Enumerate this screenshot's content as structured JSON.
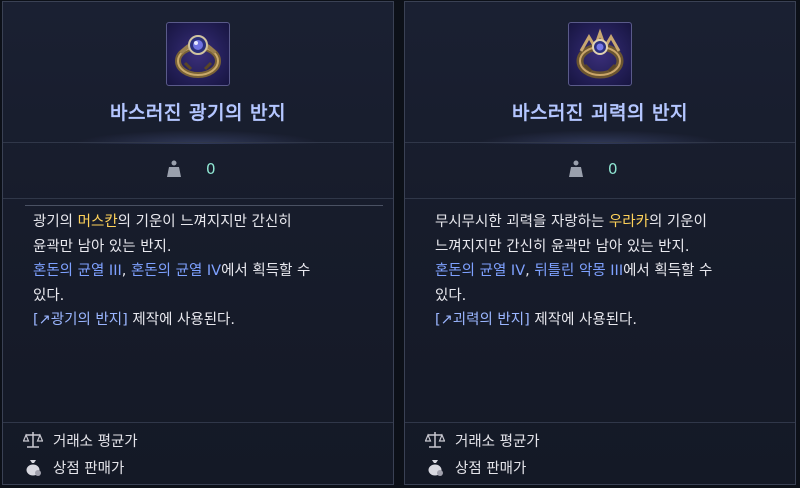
{
  "cards": [
    {
      "title": "바스러진 광기의 반지",
      "icon": "ring-icon",
      "weight_value": "0",
      "desc": {
        "line1_a": "광기의 ",
        "line1_hl": "머스칸",
        "line1_b": "의 기운이 느껴지지만 간신히",
        "line2": "윤곽만 남아 있는 반지.",
        "line3_loc1": "혼돈의 균열 III",
        "line3_sep": ", ",
        "line3_loc2": "혼돈의 균열 IV",
        "line3_b": "에서 획득할 수",
        "line4": "있다.",
        "link_text": "[↗광기의 반지]",
        "line5_b": " 제작에 사용된다."
      },
      "footer": {
        "trade_label": "거래소 평균가",
        "shop_label": "상점 판매가"
      }
    },
    {
      "title": "바스러진 괴력의 반지",
      "icon": "ring-icon",
      "weight_value": "0",
      "desc": {
        "line1_a": "무시무시한 괴력을 자랑하는 ",
        "line1_hl": "우라카",
        "line1_b": "의 기운이",
        "line2": "느껴지지만 간신히 윤곽만 남아 있는 반지.",
        "line3_loc1": "혼돈의 균열 IV",
        "line3_sep": ", ",
        "line3_loc2": "뒤틀린 악몽 III",
        "line3_b": "에서 획득할 수",
        "line4": "있다.",
        "link_text": "[↗괴력의 반지]",
        "line5_b": " 제작에 사용된다."
      },
      "footer": {
        "trade_label": "거래소 평균가",
        "shop_label": "상점 판매가"
      }
    }
  ],
  "colors": {
    "title": "#b4c6ff",
    "highlight_name": "#ffd25a",
    "location": "#7ea1ff",
    "weight": "#8fe6d2"
  }
}
